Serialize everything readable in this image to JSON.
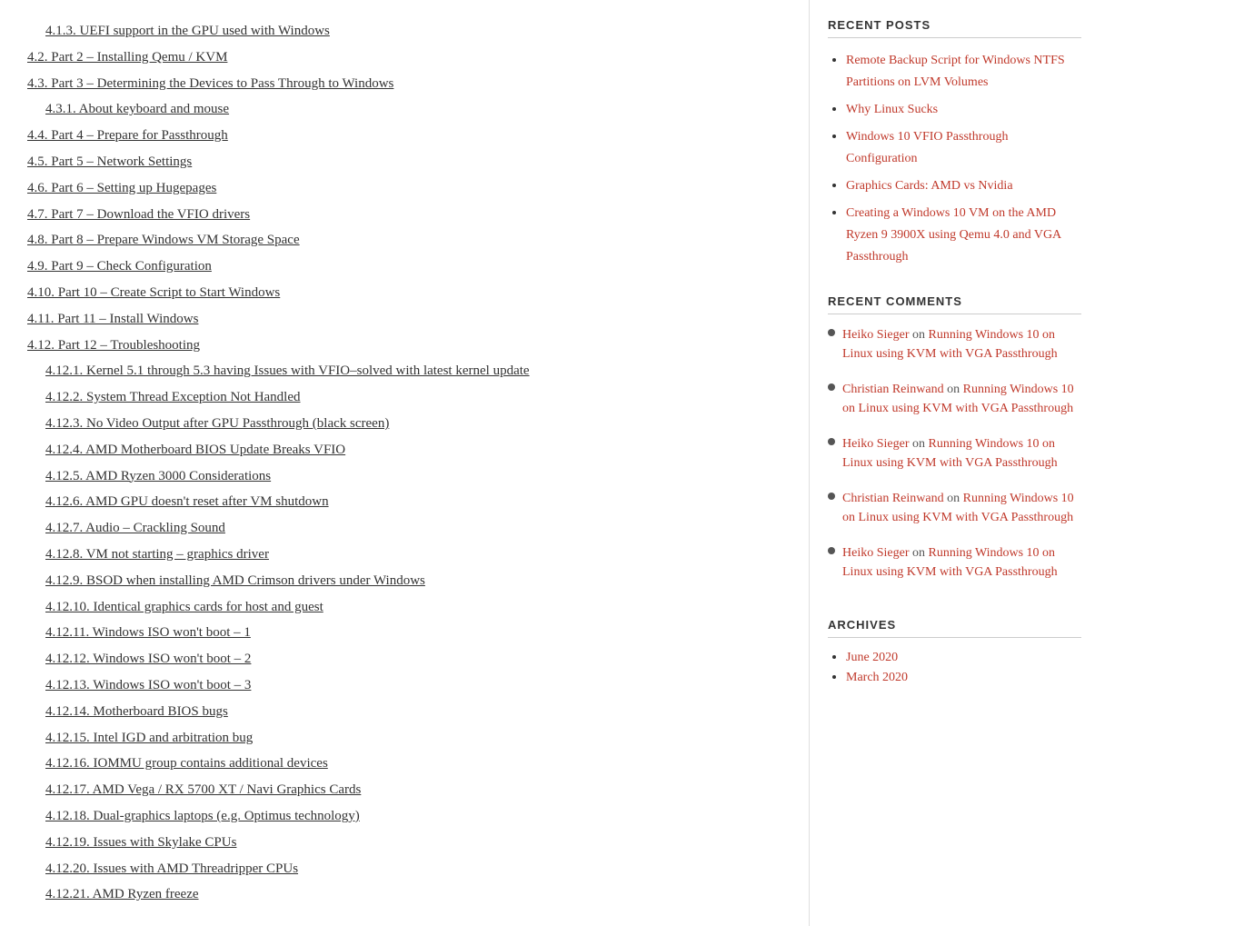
{
  "toc": {
    "items": [
      {
        "id": "toc-uefi",
        "indent": "sub",
        "text": "4.1.3. UEFI support in the GPU used with Windows",
        "href": "#"
      },
      {
        "id": "toc-part2",
        "indent": "top",
        "text": "4.2. Part 2 – Installing Qemu / KVM",
        "href": "#"
      },
      {
        "id": "toc-part3",
        "indent": "top",
        "text": "4.3. Part 3 – Determining the Devices to Pass Through to Windows",
        "href": "#"
      },
      {
        "id": "toc-keyboard",
        "indent": "sub",
        "text": "4.3.1. About keyboard and mouse",
        "href": "#"
      },
      {
        "id": "toc-part4",
        "indent": "top",
        "text": "4.4. Part 4 – Prepare for Passthrough",
        "href": "#"
      },
      {
        "id": "toc-part5",
        "indent": "top",
        "text": "4.5. Part 5 – Network Settings",
        "href": "#"
      },
      {
        "id": "toc-part6",
        "indent": "top",
        "text": "4.6. Part 6 – Setting up Hugepages",
        "href": "#"
      },
      {
        "id": "toc-part7",
        "indent": "top",
        "text": "4.7. Part 7 – Download the VFIO drivers",
        "href": "#"
      },
      {
        "id": "toc-part8",
        "indent": "top",
        "text": "4.8. Part 8 – Prepare Windows VM Storage Space",
        "href": "#"
      },
      {
        "id": "toc-part9",
        "indent": "top",
        "text": "4.9. Part 9 – Check Configuration",
        "href": "#"
      },
      {
        "id": "toc-part10",
        "indent": "top",
        "text": "4.10. Part 10 – Create Script to Start Windows",
        "href": "#"
      },
      {
        "id": "toc-part11",
        "indent": "top",
        "text": "4.11. Part 11 – Install Windows",
        "href": "#"
      },
      {
        "id": "toc-part12",
        "indent": "top",
        "text": "4.12. Part 12 – Troubleshooting",
        "href": "#"
      },
      {
        "id": "toc-kernel",
        "indent": "sub",
        "text": "4.12.1. Kernel 5.1 through 5.3 having Issues with VFIO–solved with latest kernel update",
        "href": "#"
      },
      {
        "id": "toc-system-thread",
        "indent": "sub",
        "text": "4.12.2. System Thread Exception Not Handled",
        "href": "#"
      },
      {
        "id": "toc-no-video",
        "indent": "sub",
        "text": "4.12.3. No Video Output after GPU Passthrough (black screen)",
        "href": "#"
      },
      {
        "id": "toc-amd-bios",
        "indent": "sub",
        "text": "4.12.4. AMD Motherboard BIOS Update Breaks VFIO",
        "href": "#"
      },
      {
        "id": "toc-amd-ryzen",
        "indent": "sub",
        "text": "4.12.5. AMD Ryzen 3000 Considerations",
        "href": "#"
      },
      {
        "id": "toc-amd-gpu",
        "indent": "sub",
        "text": "4.12.6. AMD GPU doesn't reset after VM shutdown",
        "href": "#"
      },
      {
        "id": "toc-audio",
        "indent": "sub",
        "text": "4.12.7. Audio – Crackling Sound",
        "href": "#"
      },
      {
        "id": "toc-vm-not-starting",
        "indent": "sub",
        "text": "4.12.8. VM not starting – graphics driver",
        "href": "#"
      },
      {
        "id": "toc-bsod",
        "indent": "sub",
        "text": "4.12.9. BSOD when installing AMD Crimson drivers under Windows",
        "href": "#"
      },
      {
        "id": "toc-identical-gpu",
        "indent": "sub",
        "text": "4.12.10. Identical graphics cards for host and guest",
        "href": "#"
      },
      {
        "id": "toc-iso-1",
        "indent": "sub",
        "text": "4.12.11. Windows ISO won't boot – 1",
        "href": "#"
      },
      {
        "id": "toc-iso-2",
        "indent": "sub",
        "text": "4.12.12. Windows ISO won't boot – 2",
        "href": "#"
      },
      {
        "id": "toc-iso-3",
        "indent": "sub",
        "text": "4.12.13. Windows ISO won't boot – 3",
        "href": "#"
      },
      {
        "id": "toc-bios-bugs",
        "indent": "sub",
        "text": "4.12.14. Motherboard BIOS bugs",
        "href": "#"
      },
      {
        "id": "toc-intel-igd",
        "indent": "sub",
        "text": "4.12.15. Intel IGD and arbitration bug",
        "href": "#"
      },
      {
        "id": "toc-iommu",
        "indent": "sub",
        "text": "4.12.16. IOMMU group contains additional devices",
        "href": "#"
      },
      {
        "id": "toc-amd-vega",
        "indent": "sub",
        "text": "4.12.17. AMD Vega / RX 5700 XT / Navi Graphics Cards",
        "href": "#"
      },
      {
        "id": "toc-dual-graphics",
        "indent": "sub",
        "text": "4.12.18. Dual-graphics laptops (e.g. Optimus technology)",
        "href": "#"
      },
      {
        "id": "toc-skylake",
        "indent": "sub",
        "text": "4.12.19. Issues with Skylake CPUs",
        "href": "#"
      },
      {
        "id": "toc-threadripper",
        "indent": "sub",
        "text": "4.12.20. Issues with AMD Threadripper CPUs",
        "href": "#"
      },
      {
        "id": "toc-amd-freeze",
        "indent": "sub",
        "text": "4.12.21. AMD Ryzen freeze",
        "href": "#"
      }
    ]
  },
  "sidebar": {
    "recent_posts": {
      "title": "RECENT POSTS",
      "items": [
        {
          "text": "Remote Backup Script for Windows NTFS Partitions on LVM Volumes",
          "href": "#"
        },
        {
          "text": "Why Linux Sucks",
          "href": "#"
        },
        {
          "text": "Windows 10 VFIO Passthrough Configuration",
          "href": "#"
        },
        {
          "text": "Graphics Cards: AMD vs Nvidia",
          "href": "#"
        },
        {
          "text": "Creating a Windows 10 VM on the AMD Ryzen 9 3900X using Qemu 4.0 and VGA Passthrough",
          "href": "#"
        }
      ]
    },
    "recent_comments": {
      "title": "RECENT COMMENTS",
      "items": [
        {
          "commenter": "Heiko Sieger",
          "on": "on",
          "post": "Running Windows 10 on Linux using KVM with VGA Passthrough",
          "post_href": "#"
        },
        {
          "commenter": "Christian Reinwand",
          "on": "on",
          "post": "Running Windows 10 on Linux using KVM with VGA Passthrough",
          "post_href": "#"
        },
        {
          "commenter": "Heiko Sieger",
          "on": "on",
          "post": "Running Windows 10 on Linux using KVM with VGA Passthrough",
          "post_href": "#"
        },
        {
          "commenter": "Christian Reinwand",
          "on": "on",
          "post": "Running Windows 10 on Linux using KVM with VGA Passthrough",
          "post_href": "#"
        },
        {
          "commenter": "Heiko Sieger",
          "on": "on",
          "post": "Running Windows 10 on Linux using KVM with VGA Passthrough",
          "post_href": "#"
        }
      ]
    },
    "archives": {
      "title": "ARCHIVES",
      "items": [
        {
          "text": "June 2020",
          "href": "#"
        },
        {
          "text": "March 2020",
          "href": "#"
        }
      ]
    }
  }
}
